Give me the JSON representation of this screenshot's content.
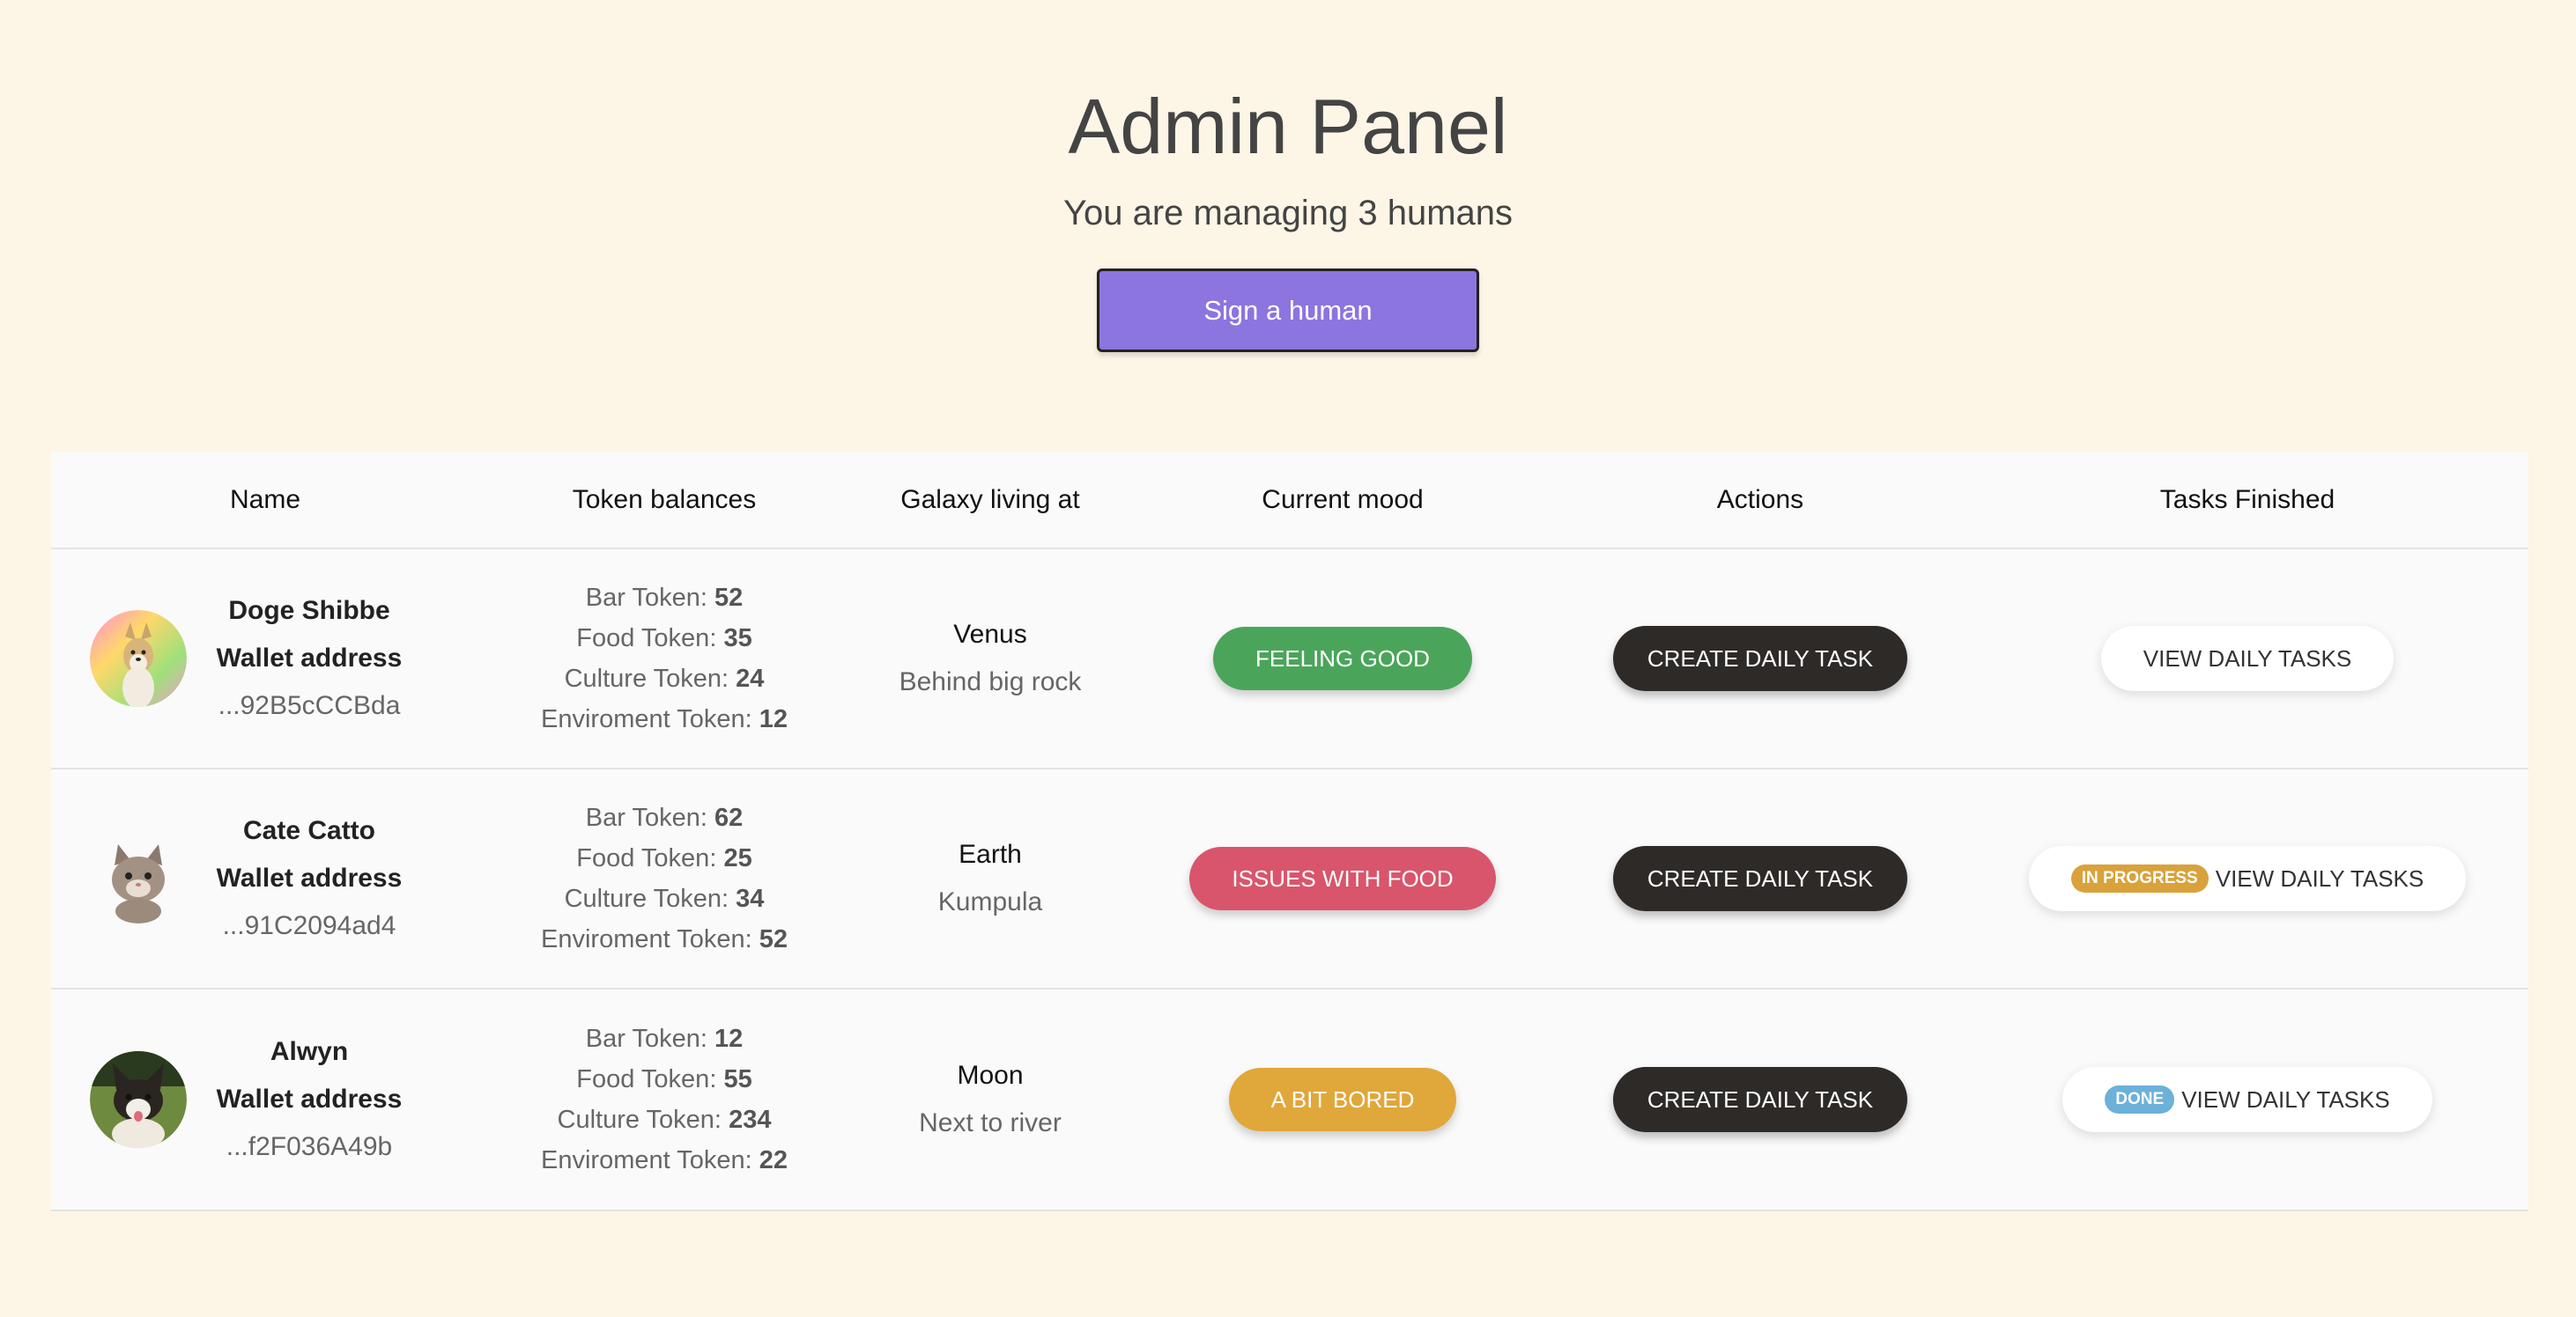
{
  "header": {
    "title": "Admin Panel",
    "subtitle": "You are managing 3 humans",
    "sign_button": "Sign a human"
  },
  "table": {
    "columns": [
      "Name",
      "Token balances",
      "Galaxy living at",
      "Current mood",
      "Actions",
      "Tasks Finished"
    ],
    "token_labels": {
      "bar": "Bar Token: ",
      "food": "Food Token: ",
      "culture": "Culture Token: ",
      "env": "Enviroment Token: "
    },
    "wallet_label": "Wallet address",
    "create_label": "CREATE DAILY TASK",
    "view_label": "VIEW DAILY TASKS",
    "rows": [
      {
        "name": "Doge Shibbe",
        "wallet": "...92B5cCCBda",
        "bar": "52",
        "food": "35",
        "culture": "24",
        "env": "12",
        "planet": "Venus",
        "location": "Behind big rock",
        "mood": "FEELING GOOD",
        "mood_color": "#4aa55a",
        "task_badge": ""
      },
      {
        "name": "Cate Catto",
        "wallet": "...91C2094ad4",
        "bar": "62",
        "food": "25",
        "culture": "34",
        "env": "52",
        "planet": "Earth",
        "location": "Kumpula",
        "mood": "ISSUES WITH FOOD",
        "mood_color": "#d9556b",
        "task_badge": "IN PROGRESS"
      },
      {
        "name": "Alwyn",
        "wallet": "...f2F036A49b",
        "bar": "12",
        "food": "55",
        "culture": "234",
        "env": "22",
        "planet": "Moon",
        "location": "Next to river",
        "mood": "A BIT BORED",
        "mood_color": "#e0a73a",
        "task_badge": "DONE"
      }
    ]
  },
  "colors": {
    "background": "#fdf6e7",
    "primary_button": "#8c75de",
    "dark_button": "#2e2a28",
    "badge_in_progress": "#d9a23b",
    "badge_done": "#6cb1d9"
  }
}
